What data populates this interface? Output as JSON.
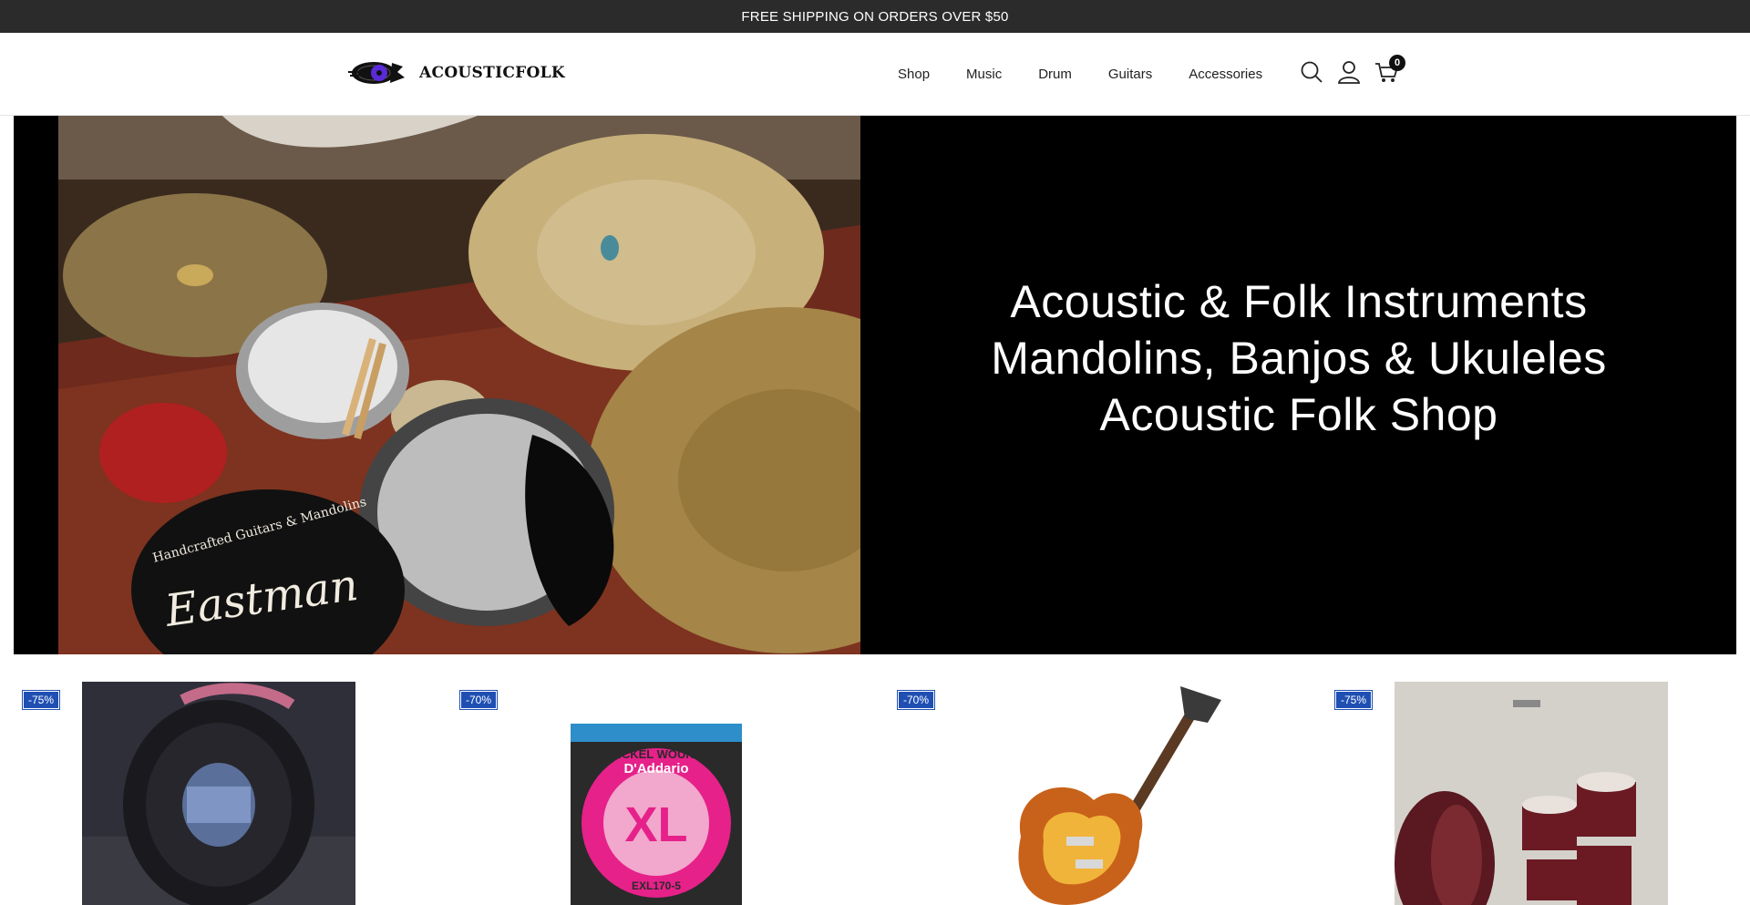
{
  "announcement": "FREE SHIPPING ON ORDERS OVER $50",
  "brand": {
    "name": "ACOUSTICFOLK",
    "accent": "#5a2ad9"
  },
  "nav": [
    {
      "label": "Shop"
    },
    {
      "label": "Music"
    },
    {
      "label": "Drum"
    },
    {
      "label": "Guitars"
    },
    {
      "label": "Accessories"
    }
  ],
  "header_icons": [
    "search-icon",
    "user-icon",
    "cart-icon"
  ],
  "cart": {
    "count": "0"
  },
  "hero": {
    "lines": [
      "Acoustic & Folk Instruments",
      "Mandolins, Banjos & Ukuleles",
      "Acoustic Folk Shop"
    ],
    "photo_text": {
      "drum_head_brand": "Eastman",
      "drum_head_tagline": "Handcrafted Guitars & Mandolins"
    }
  },
  "products": [
    {
      "discount": "-75%",
      "image": "cable-reel"
    },
    {
      "discount": "-70%",
      "image": "bass-strings",
      "package_brand": "D'Addario",
      "package_text": "NICKEL WOUND",
      "package_size": "XL",
      "package_code": "EXL170-5"
    },
    {
      "discount": "-70%",
      "image": "electric-guitar"
    },
    {
      "discount": "-75%",
      "image": "drum-kit"
    }
  ],
  "colors": {
    "announcement_bg": "#2b2b2b",
    "badge_bg": "#1f4fb3",
    "hero_bg": "#000000"
  }
}
